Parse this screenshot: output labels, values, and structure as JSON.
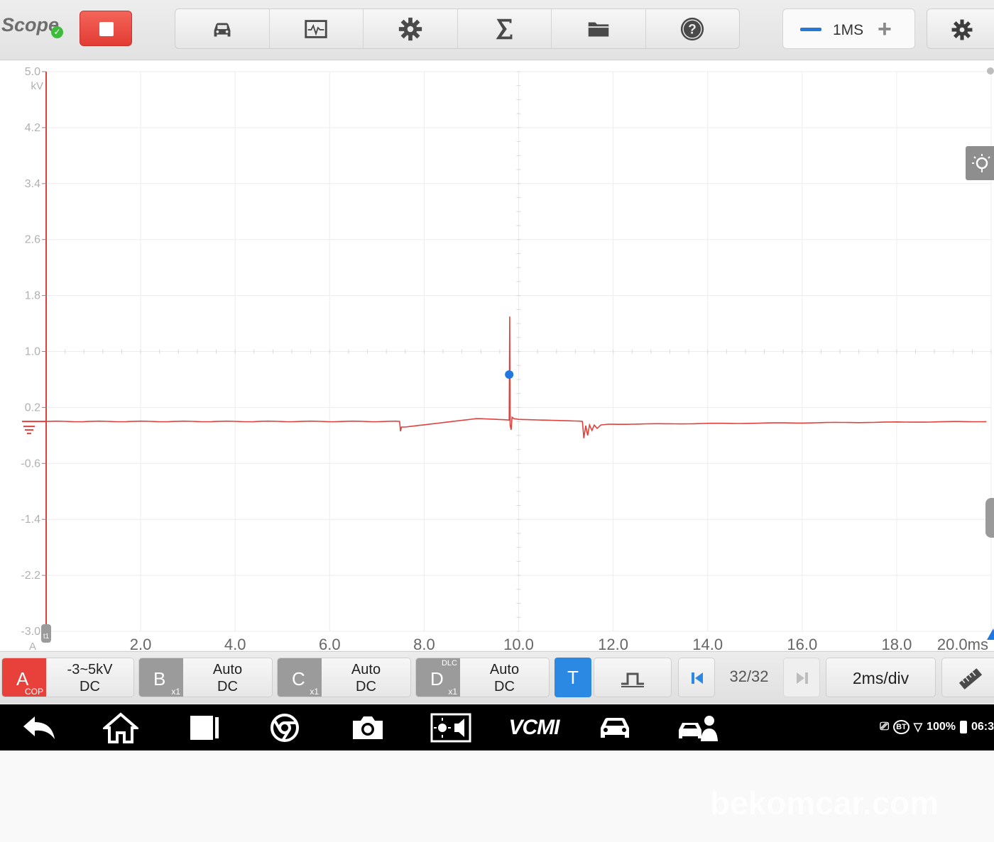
{
  "app": {
    "title": "Scope"
  },
  "toolbar": {
    "buttons": [
      "vehicle",
      "waveform-library",
      "settings",
      "math",
      "files",
      "help"
    ],
    "sample_rate": "1MS"
  },
  "scope": {
    "y_unit": "kV",
    "y_ticks": [
      "5.0",
      "4.2",
      "3.4",
      "2.6",
      "1.8",
      "1.0",
      "0.2",
      "-0.6",
      "-1.4",
      "-2.2",
      "-3.0"
    ],
    "x_ticks": [
      "2.0",
      "4.0",
      "6.0",
      "8.0",
      "10.0",
      "12.0",
      "14.0",
      "16.0",
      "18.0",
      "20.0ms"
    ],
    "channel_marker": "A",
    "cursor_marker": "t1",
    "trace_color": "#e0413b",
    "trigger_color": "#1f77e0"
  },
  "channels": [
    {
      "label": "A",
      "sub": "COP",
      "line1": "-3~5kV",
      "line2": "DC",
      "color": "#e8403a"
    },
    {
      "label": "B",
      "sub": "x1",
      "line1": "Auto",
      "line2": "DC",
      "color": "#9b9b9b"
    },
    {
      "label": "C",
      "sub": "x1",
      "line1": "Auto",
      "line2": "DC",
      "color": "#9b9b9b"
    },
    {
      "label": "D",
      "sub": "x1",
      "sup": "DLC",
      "line1": "Auto",
      "line2": "DC",
      "color": "#9b9b9b"
    }
  ],
  "controls": {
    "trigger_label": "T",
    "frame_counter": "32/32",
    "timebase": "2ms/div"
  },
  "navbar": {
    "vcm_label": "VCMI",
    "battery": "100%",
    "time": "06:3",
    "bt": "BT"
  },
  "watermark": "bekomcar.com"
}
